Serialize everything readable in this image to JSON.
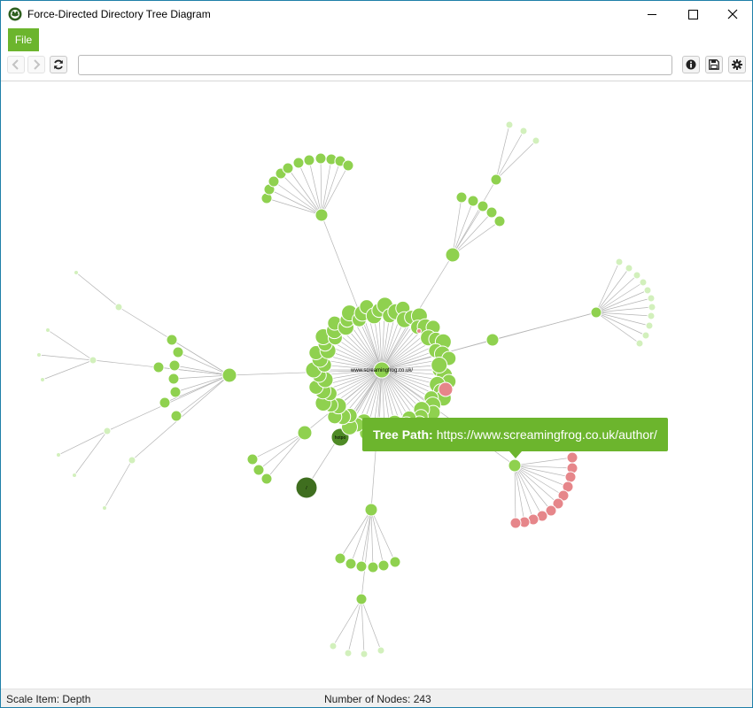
{
  "window": {
    "title": "Force-Directed Directory Tree Diagram"
  },
  "menu": {
    "file_label": "File"
  },
  "toolbar": {
    "url_value": ""
  },
  "diagram": {
    "root_label": "www.screamingfrog.co.uk/",
    "node_labels": [
      "hotpo",
      "/"
    ],
    "colors": {
      "node_green": "#8fd14f",
      "node_light": "#d2f0bc",
      "node_dark": "#3f6e1f",
      "node_dark2": "#4e8a25",
      "node_red": "#e6868a",
      "link": "#b5b5b5"
    }
  },
  "tooltip": {
    "label": "Tree Path:",
    "value": "https://www.screamingfrog.co.uk/author/"
  },
  "status": {
    "scale_item": "Scale Item: Depth",
    "node_count": "Number of Nodes: 243"
  }
}
